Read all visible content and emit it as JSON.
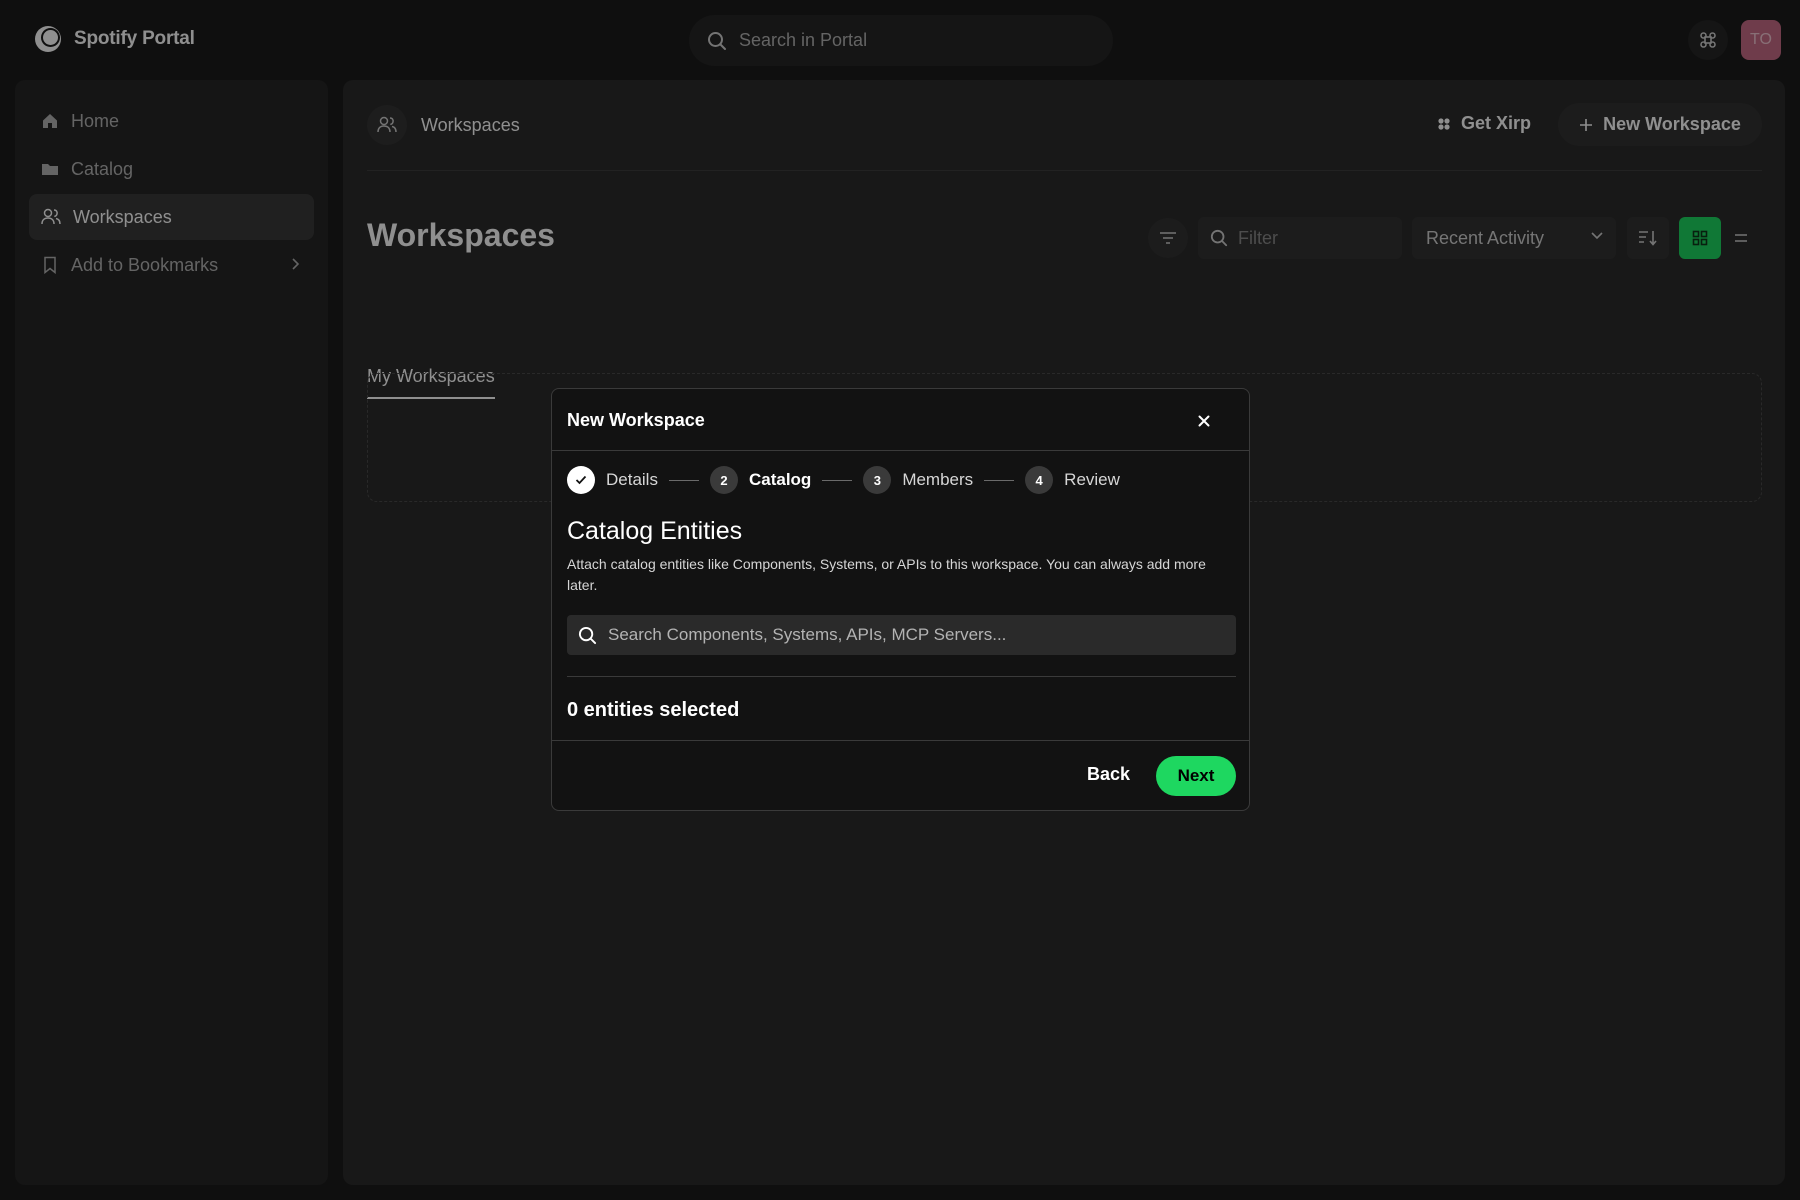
{
  "app": {
    "name": "Spotify Portal"
  },
  "header": {
    "search_placeholder": "Search in Portal",
    "avatar_initials": "TO"
  },
  "sidebar": {
    "items": [
      {
        "label": "Home",
        "icon": "home-icon"
      },
      {
        "label": "Catalog",
        "icon": "folder-icon"
      },
      {
        "label": "Workspaces",
        "icon": "users-icon",
        "active": true
      },
      {
        "label": "Add to Bookmarks",
        "icon": "bookmark-icon"
      }
    ]
  },
  "main": {
    "breadcrumb": "Workspaces",
    "get_xirp_label": "Get Xirp",
    "new_workspace_label": "New Workspace",
    "page_title": "Workspaces",
    "filter_placeholder": "Filter",
    "sort_selected": "Recent Activity",
    "tabs": [
      {
        "label": "My Workspaces",
        "active": true
      }
    ]
  },
  "modal": {
    "title": "New Workspace",
    "steps": [
      {
        "number": "1",
        "label": "Details",
        "state": "done"
      },
      {
        "number": "2",
        "label": "Catalog",
        "state": "current"
      },
      {
        "number": "3",
        "label": "Members",
        "state": "pending"
      },
      {
        "number": "4",
        "label": "Review",
        "state": "pending"
      }
    ],
    "section_title": "Catalog Entities",
    "section_description": "Attach catalog entities like Components, Systems, or APIs to this workspace. You can always add more later.",
    "search_placeholder": "Search Components, Systems, APIs, MCP Servers...",
    "selected_count_text": "0 entities selected",
    "back_label": "Back",
    "next_label": "Next"
  },
  "colors": {
    "accent": "#1ed760",
    "background": "#1b1b1b",
    "modal_background": "#121212",
    "avatar": "#c66b86"
  }
}
